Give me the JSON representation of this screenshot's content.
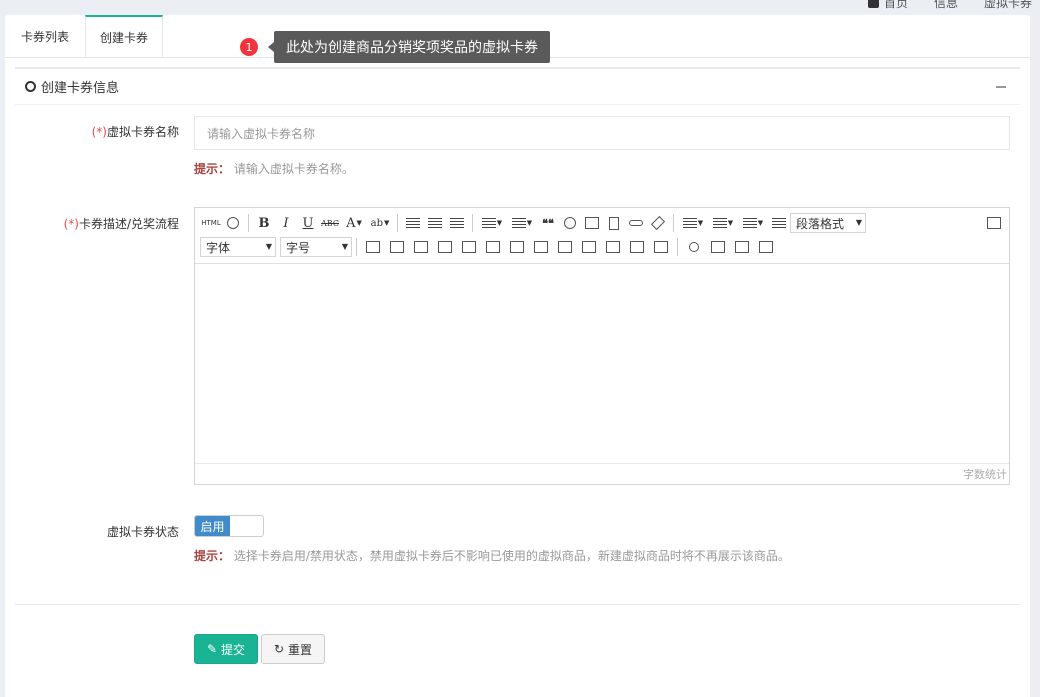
{
  "topbar": {
    "items": [
      "首页",
      "信息",
      "虚拟卡券"
    ]
  },
  "tabs": [
    {
      "label": "卡券列表"
    },
    {
      "label": "创建卡券"
    }
  ],
  "tip": {
    "num": "1",
    "text": "此处为创建商品分销奖项奖品的虚拟卡券"
  },
  "panel": {
    "title": "创建卡券信息"
  },
  "form": {
    "required_mark": "(*)",
    "name_label": "虚拟卡券名称",
    "name_placeholder": "请输入虚拟卡券名称",
    "hint_prefix": "提示：",
    "name_hint": "请输入虚拟卡券名称。",
    "desc_label": "卡券描述/兑奖流程",
    "status_label": "虚拟卡券状态",
    "status_value": "启用",
    "status_hint": "选择卡券启用/禁用状态，禁用虚拟卡券后不影响已使用的虚拟商品，新建虚拟商品时将不再展示该商品。"
  },
  "editor": {
    "html_label": "HTML",
    "bold": "B",
    "italic": "I",
    "underline": "U",
    "strike": "ABC",
    "fontcolor": "A",
    "bgcolor": "ab",
    "quote": "❝❝",
    "paragraph": "段落格式",
    "font_family": "字体",
    "font_size": "字号",
    "wordcount": "字数统计"
  },
  "buttons": {
    "submit": "提交",
    "reset": "重置"
  }
}
